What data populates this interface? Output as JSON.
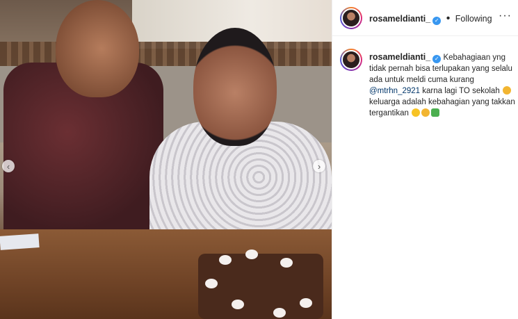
{
  "post": {
    "username": "rosameldianti_",
    "verified_icon": "verified-badge-icon",
    "separator": "•",
    "follow_status": "Following",
    "more_icon": "more-options-icon",
    "more_glyph": "···"
  },
  "caption": {
    "username": "rosameldianti_",
    "line1": "Kebahagiaan yng tidak pernah bisa terlupakan yang selalu ada untuk meldi cuma kurang",
    "mention": "@mtrhn_2921",
    "line2": "karna lagi TO sekolah",
    "line3": "keluarga adalah kebahagian yang takkan tergantikan"
  },
  "carousel": {
    "prev_glyph": "‹",
    "next_glyph": "›"
  },
  "colors": {
    "verified": "#3897f0",
    "mention": "#003569",
    "text": "#262626"
  }
}
